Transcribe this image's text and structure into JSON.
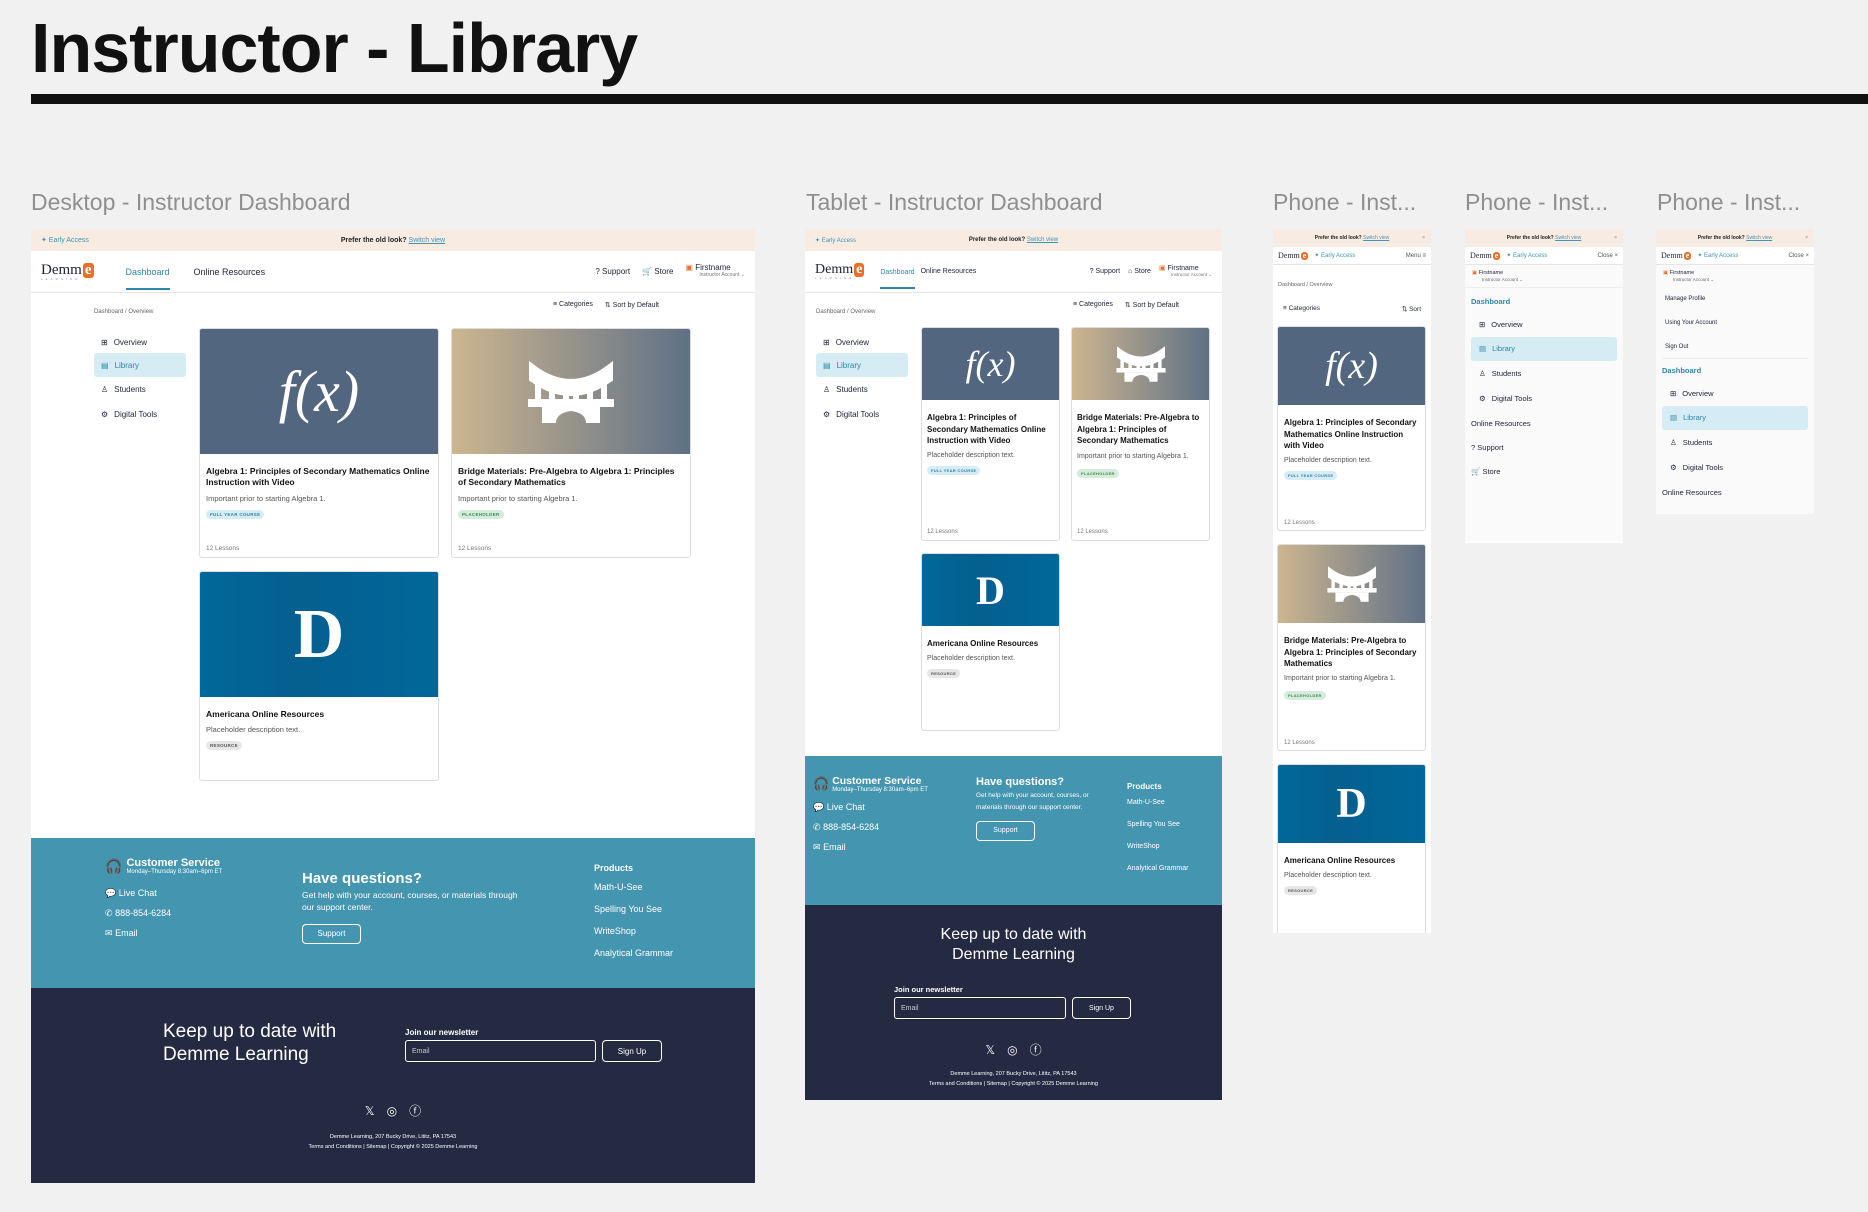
{
  "page_title": "Instructor - Library",
  "frames": {
    "desktop": "Desktop - Instructor Dashboard",
    "tablet": "Tablet - Instructor Dashboard",
    "phone1": "Phone - Inst...",
    "phone2": "Phone - Inst...",
    "phone3": "Phone - Inst..."
  },
  "banner": {
    "early_access": "✦ Early Access",
    "early_access_short": "✦ Early Access",
    "prefer": "Prefer the old look?",
    "switch": "Switch view",
    "close": "×"
  },
  "header": {
    "logo_word": "Demm",
    "logo_e": "e",
    "logo_sub": "LEARNING",
    "tabs": [
      "Dashboard",
      "Online Resources"
    ],
    "support": "Support",
    "store": "Store",
    "firstname": "Firstname",
    "account": "Instructor Account ⌄",
    "menu": "Menu",
    "close": "Close"
  },
  "breadcrumb": "Dashboard / Overview",
  "toolbar": {
    "categories": "Categories",
    "sort": "Sort by Default",
    "sort_short": "Sort"
  },
  "sidebar": [
    "Overview",
    "Library",
    "Students",
    "Digital Tools"
  ],
  "cards": [
    {
      "title": "Algebra 1: Principles of Secondary Mathematics Online Instruction with Video",
      "desc": "Important prior to starting Algebra 1.",
      "badge": "FULL YEAR COURSE",
      "lessons": "12 Lessons",
      "thumb": "f(x)"
    },
    {
      "title": "Bridge Materials: Pre-Algebra to Algebra 1: Principles of Secondary Mathematics",
      "desc": "Important prior to starting Algebra 1.",
      "badge": "PLACEHOLDER",
      "lessons": "12 Lessons",
      "thumb": "bridge-icon"
    },
    {
      "title": "Americana Online Resources",
      "desc": "Placeholder description text.",
      "badge": "RESOURCE",
      "thumb": "D"
    }
  ],
  "tablet_card1_desc": "Placeholder description text.",
  "footer": {
    "cs_title": "Customer Service",
    "cs_hours": "Monday–Thursday 8:30am–6pm ET",
    "live_chat": "Live Chat",
    "phone": "888-854-6284",
    "email": "Email",
    "q_title": "Have questions?",
    "q_text": "Get help with your account, courses, or materials through our support center.",
    "support_btn": "Support",
    "products_title": "Products",
    "products": [
      "Math-U-See",
      "Spelling You See",
      "WriteShop",
      "Analytical Grammar"
    ],
    "keep": "Keep up to date with Demme Learning",
    "newsletter": "Join our newsletter",
    "email_ph": "Email",
    "signup": "Sign Up",
    "address": "Demme Learning, 207 Bucky Drive, Lititz, PA 17543",
    "legal": "Terms and Conditions | Sitemap | Copyright © 2025 Demme Learning"
  },
  "phone_menu_account": {
    "firstname": "Firstname",
    "account": "Instructor Account ⌄",
    "items": [
      "Manage Profile",
      "Using Your Account",
      "Sign Out"
    ]
  },
  "phone_menu_nav": {
    "dashboard": "Dashboard",
    "online_resources": "Online Resources",
    "support": "Support",
    "store": "Store"
  },
  "colors": {
    "accent": "#2e86a6",
    "footer_blue": "#4495b0",
    "footer_dark": "#242a42",
    "banner": "#f8ebe2",
    "logo_orange": "#e8702a"
  }
}
